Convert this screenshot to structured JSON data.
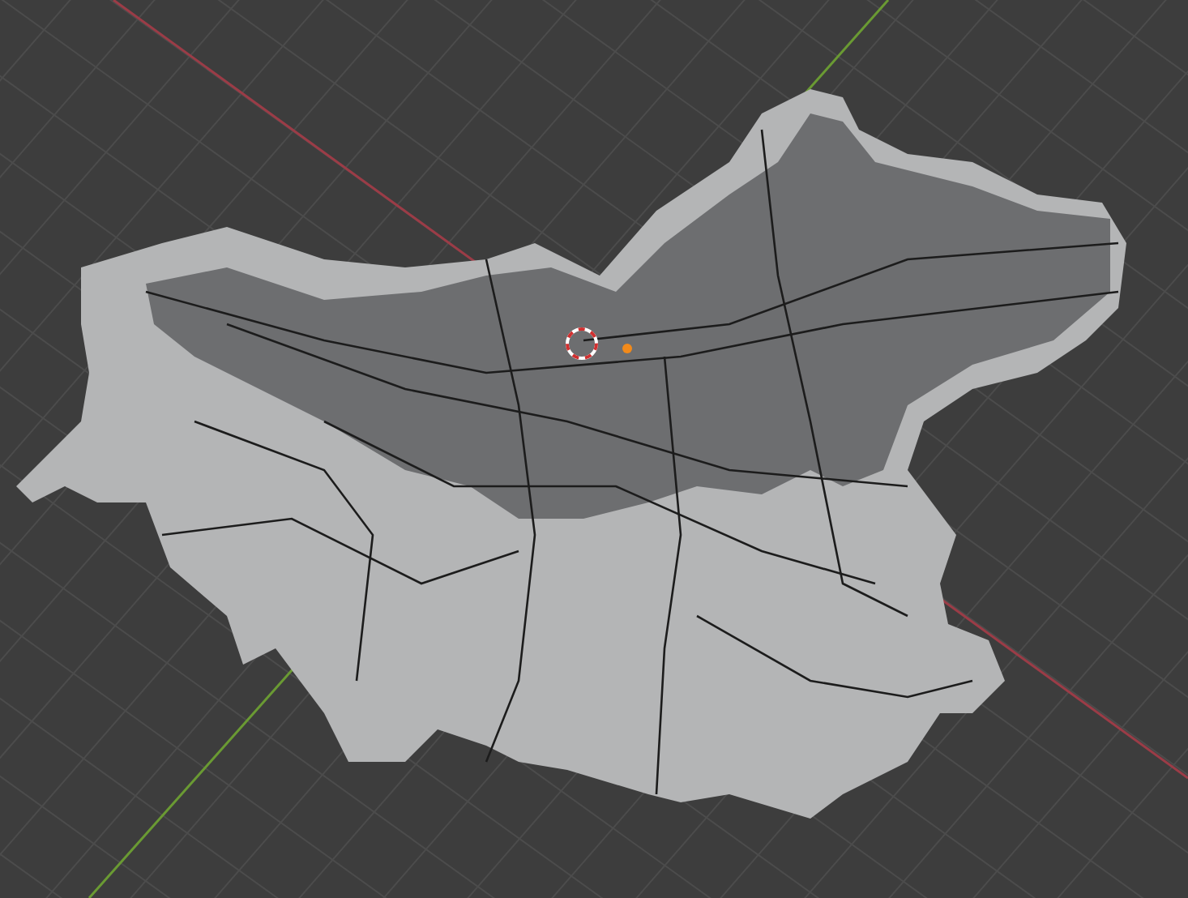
{
  "viewport": {
    "show_3d_cursor": true,
    "show_origin": true
  }
}
